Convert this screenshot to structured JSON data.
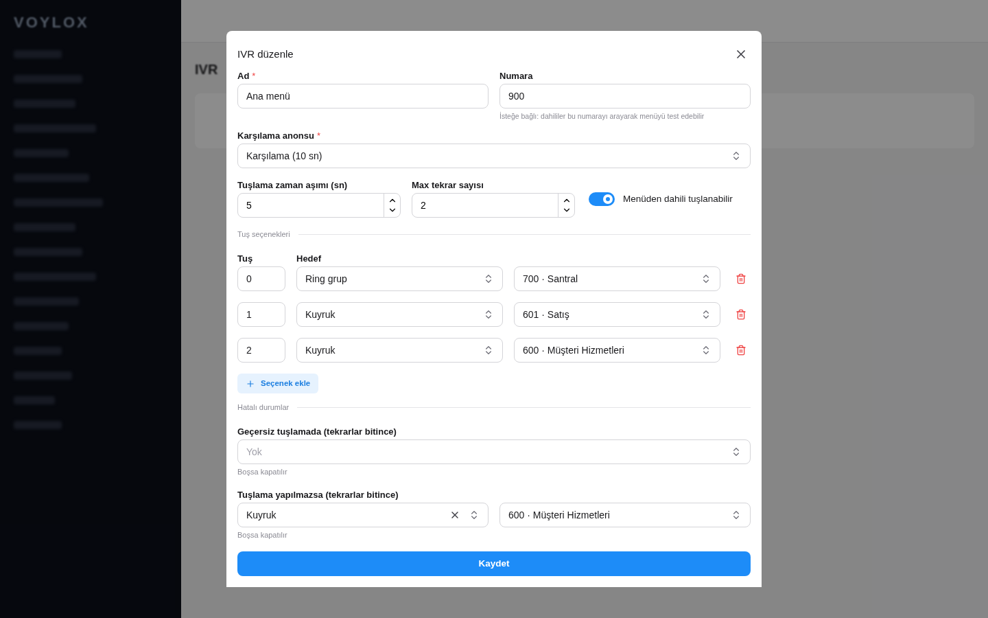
{
  "background": {
    "logo": "VOYLOX",
    "page_title": "IVR"
  },
  "dialog": {
    "title": "IVR düzenle",
    "fields": [
      {
        "label": "Ad",
        "marker": "*",
        "value": "Ana menü"
      },
      {
        "label": "Numara",
        "value": "900",
        "hint": "İsteğe bağlı: dahililer bu numarayı arayarak menüyü test edebilir"
      }
    ],
    "greeting": {
      "label": "Karşılama anonsu",
      "marker": "*",
      "value": "Karşılama (10 sn)"
    },
    "numbers": [
      {
        "label": "Tuşlama zaman aşımı (sn)",
        "value": "5"
      },
      {
        "label": "Max tekrar sayısı",
        "value": "2"
      }
    ],
    "toggle": {
      "label": "Menüden dahili tuşlanabilir",
      "on": true
    },
    "key_section": "Tuş seçenekleri",
    "key_header": "Tuş",
    "target_header": "Hedef",
    "options": [
      {
        "key": "0",
        "type": "Ring grup",
        "target": "700 · Santral"
      },
      {
        "key": "1",
        "type": "Kuyruk",
        "target": "601 · Satış"
      },
      {
        "key": "2",
        "type": "Kuyruk",
        "target": "600 · Müşteri Hizmetleri"
      }
    ],
    "add_button": "Seçenek ekle",
    "error_section": "Hatalı durumlar",
    "invalid": {
      "label": "Geçersiz tuşlamada (tekrarlar bitince)",
      "placeholder": "Yok",
      "hint": "Boşsa kapatılır"
    },
    "no_input": {
      "label": "Tuşlama yapılmazsa (tekrarlar bitince)",
      "type": "Kuyruk",
      "target": "600 · Müşteri Hizmetleri",
      "hint": "Boşsa kapatılır"
    },
    "save_button": "Kaydet"
  }
}
